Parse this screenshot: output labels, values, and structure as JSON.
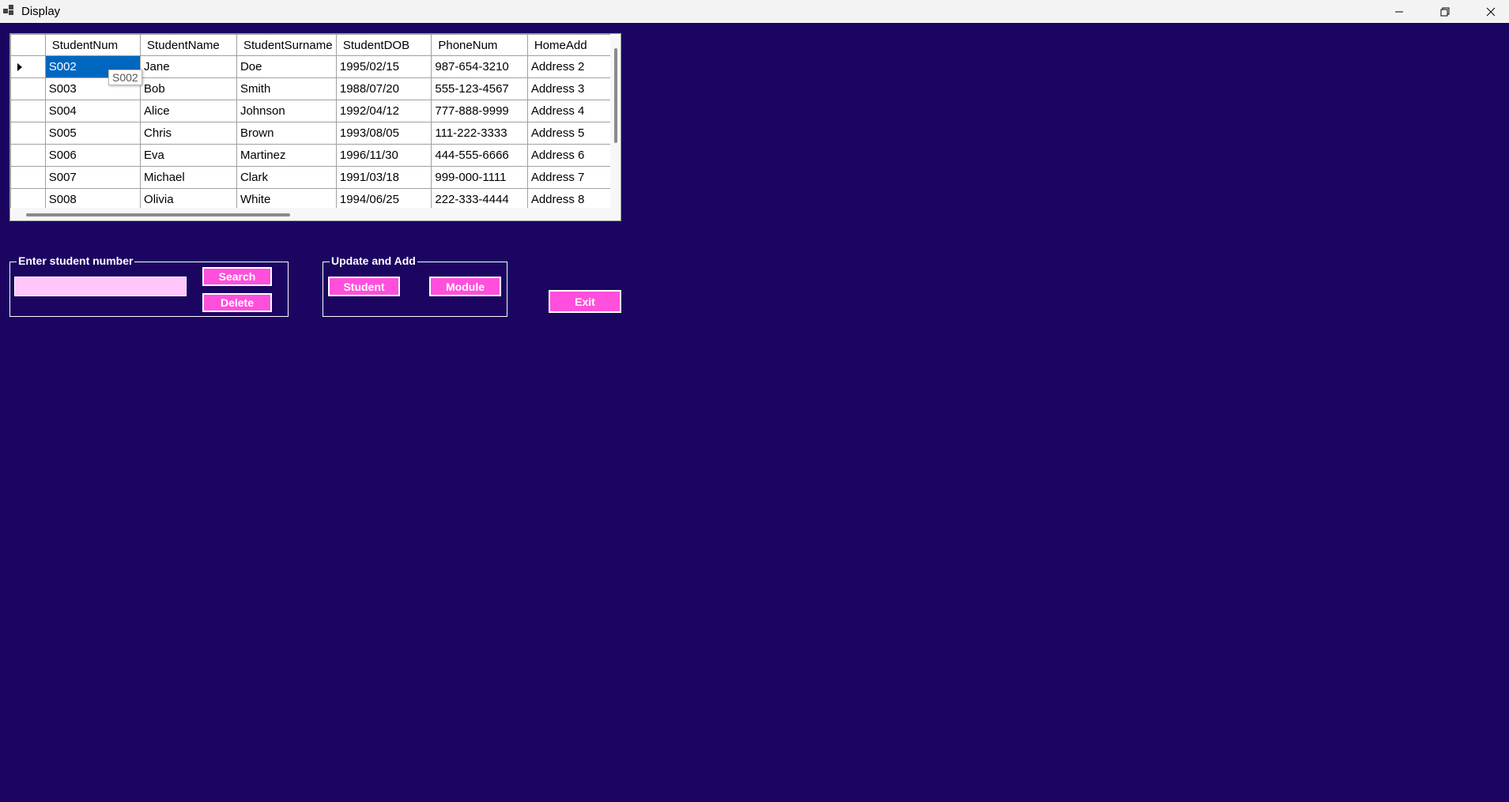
{
  "window": {
    "title": "Display",
    "icon": "app-window-icon"
  },
  "grid": {
    "columns": [
      "StudentNum",
      "StudentName",
      "StudentSurname",
      "StudentDOB",
      "PhoneNum",
      "HomeAdd"
    ],
    "rows": [
      [
        "S002",
        "Jane",
        "Doe",
        "1995/02/15",
        "987-654-3210",
        "Address 2"
      ],
      [
        "S003",
        "Bob",
        "Smith",
        "1988/07/20",
        "555-123-4567",
        "Address 3"
      ],
      [
        "S004",
        "Alice",
        "Johnson",
        "1992/04/12",
        "777-888-9999",
        "Address 4"
      ],
      [
        "S005",
        "Chris",
        "Brown",
        "1993/08/05",
        "111-222-3333",
        "Address 5"
      ],
      [
        "S006",
        "Eva",
        "Martinez",
        "1996/11/30",
        "444-555-6666",
        "Address 6"
      ],
      [
        "S007",
        "Michael",
        "Clark",
        "1991/03/18",
        "999-000-1111",
        "Address 7"
      ],
      [
        "S008",
        "Olivia",
        "White",
        "1994/06/25",
        "222-333-4444",
        "Address 8"
      ]
    ],
    "tooltip": "S002"
  },
  "search_group": {
    "title": "Enter student number",
    "input_value": "",
    "search_label": "Search",
    "delete_label": "Delete"
  },
  "update_group": {
    "title": "Update and Add",
    "student_label": "Student",
    "module_label": "Module"
  },
  "exit_label": "Exit",
  "colors": {
    "background": "#1b0561",
    "button": "#ff4fdc",
    "input": "#ffc6fb",
    "selection": "#0067c0"
  }
}
